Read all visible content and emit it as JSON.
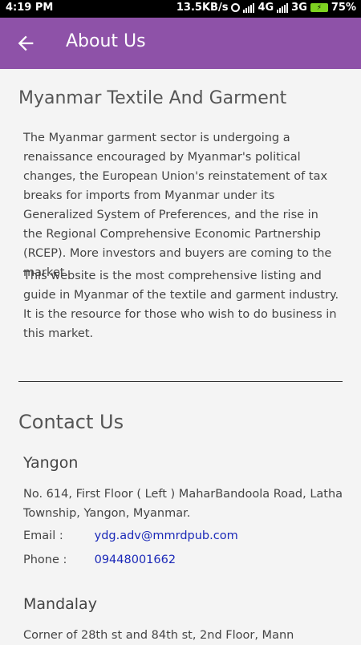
{
  "status_bar": {
    "time": "4:19 PM",
    "network_speed": "13.5KB/s",
    "network_type_1": "4G",
    "network_type_2": "3G",
    "battery": "75%"
  },
  "app_bar": {
    "title": "About Us",
    "back_icon": "arrow-left-icon"
  },
  "about": {
    "heading": "Myanmar Textile And Garment",
    "paragraph_1": "The Myanmar garment sector is undergoing a renaissance encouraged by Myanmar's political changes, the European Union's reinstatement of tax breaks for imports from Myanmar under its Generalized System of Preferences, and the rise in the Regional Comprehensive Economic Partnership (RCEP). More investors and buyers are coming to the market.",
    "paragraph_2": "This website is the most comprehensive listing and guide in Myanmar of the textile and garment industry. It is the resource for those who wish to do business in this market."
  },
  "contact": {
    "heading": "Contact Us",
    "offices": [
      {
        "city": "Yangon",
        "address": "No. 614, First Floor ( Left ) MaharBandoola Road, Latha Township, Yangon, Myanmar.",
        "email_label": "Email   :",
        "email": "ydg.adv@mmrdpub.com",
        "phone_label": "Phone  :",
        "phone": "09448001662"
      },
      {
        "city": "Mandalay",
        "address": "Corner of 28th st and 84th st, 2nd Floor, Mann"
      }
    ]
  },
  "colors": {
    "app_bar": "#8e52a8",
    "link": "#1a28b8",
    "background": "#f4f4f4"
  }
}
